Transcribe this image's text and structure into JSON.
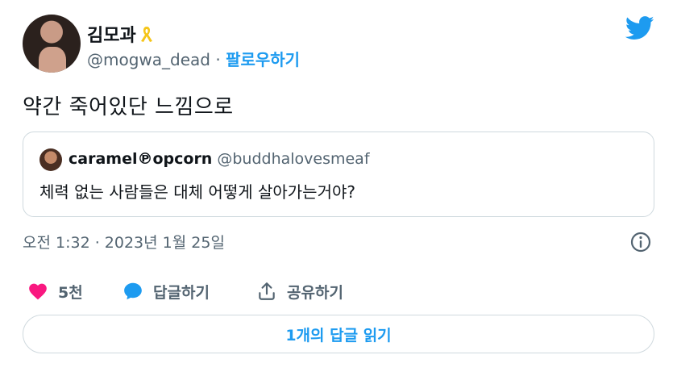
{
  "author": {
    "name": "김모과",
    "badge_icon": "yellow-ribbon-icon",
    "handle": "@mogwa_dead",
    "separator": "·",
    "follow_label": "팔로우하기"
  },
  "brand": {
    "icon": "twitter-bird-icon",
    "color": "#1d9bf0"
  },
  "tweet": {
    "text": "약간 죽어있단 느낌으로"
  },
  "quote": {
    "name": "caramel℗opcorn",
    "handle": "@buddhalovesmeaf",
    "text": "체력 없는 사람들은 대체 어떻게 살아가는거야?"
  },
  "meta": {
    "timestamp": "오전 1:32 · 2023년 1월 25일",
    "info_icon": "info-icon"
  },
  "actions": {
    "like_count": "5천",
    "reply_label": "답글하기",
    "share_label": "공유하기"
  },
  "replies_button": {
    "label": "1개의 답글 읽기"
  },
  "colors": {
    "like": "#f91880",
    "accent": "#1d9bf0",
    "muted": "#536471",
    "border": "#cfd9de"
  }
}
